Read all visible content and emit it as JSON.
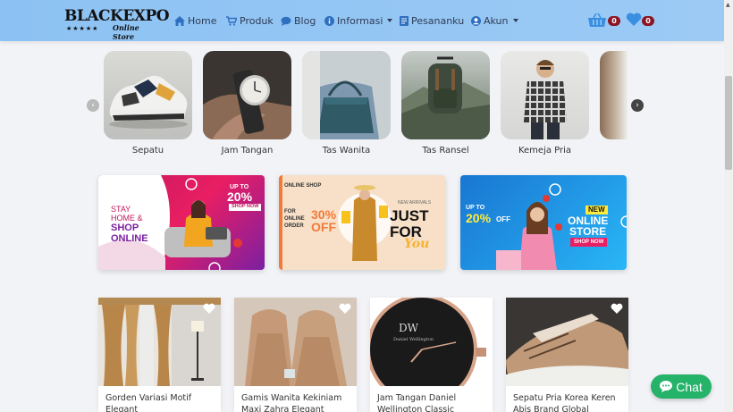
{
  "logo": {
    "main": "BLACKEXPO",
    "sub": "Online Store",
    "stars": "★★★★★"
  },
  "nav": {
    "home": "Home",
    "produk": "Produk",
    "blog": "Blog",
    "informasi": "Informasi",
    "pesanan": "Pesananku",
    "akun": "Akun",
    "cart_count": "0",
    "wishlist_count": "0"
  },
  "categories": [
    {
      "label": "Sepatu"
    },
    {
      "label": "Jam Tangan"
    },
    {
      "label": "Tas Wanita"
    },
    {
      "label": "Tas Ransel"
    },
    {
      "label": "Kemeja Pria"
    }
  ],
  "banners": {
    "b1": {
      "up_to": "UP TO",
      "percent": "20%",
      "shop_now": "SHOP NOW",
      "line1": "STAY",
      "line2": "HOME &",
      "line3": "SHOP",
      "line4": "ONLINE"
    },
    "b2": {
      "brand": "ONLINE SHOP",
      "online_order": "FOR ONLINE ORDER",
      "percent": "30%",
      "off": "OFF",
      "new_arrivals": "NEW ARRIVALS",
      "just": "JUST",
      "for": "FOR",
      "you": "You"
    },
    "b3": {
      "up_to": "UP TO",
      "percent": "20%",
      "off": "OFF",
      "new": "NEW",
      "online": "ONLINE",
      "store": "STORE",
      "shop_now": "SHOP NOW"
    }
  },
  "products": [
    {
      "title": "Gorden Variasi Motif Elegant"
    },
    {
      "title": "Gamis Wanita Kekiniam Maxi Zahra Elegant"
    },
    {
      "title": "Jam Tangan Daniel Wellington Classic Sheffield"
    },
    {
      "title": "Sepatu Pria Korea Keren Abis Brand Global"
    }
  ],
  "chat": {
    "label": "Chat"
  },
  "colors": {
    "accent": "#8cc2f3",
    "badge": "#8b1524",
    "chat": "#25b36a"
  }
}
